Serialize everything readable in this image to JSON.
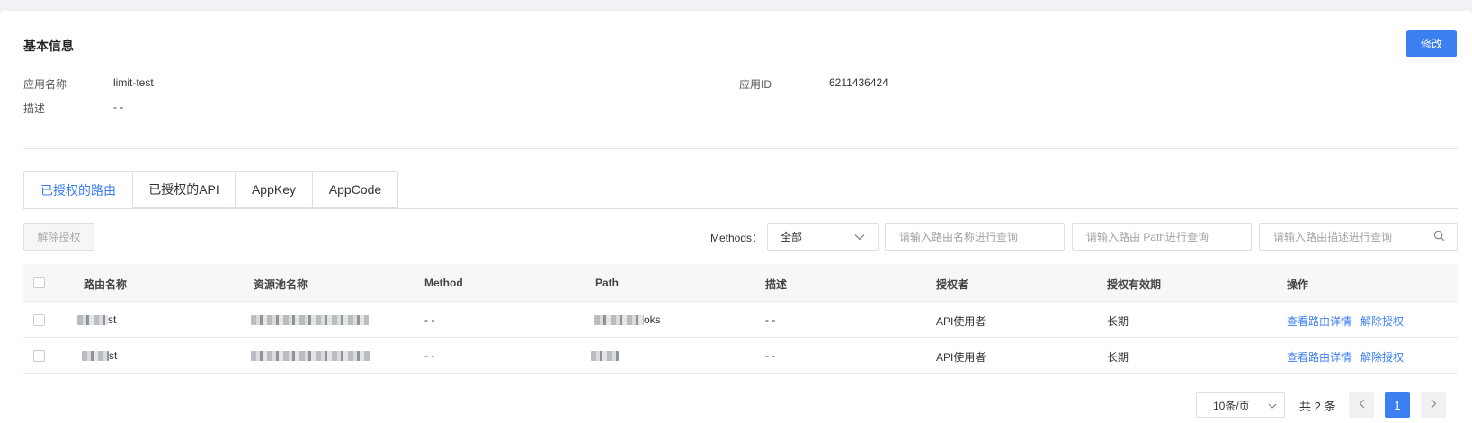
{
  "basic": {
    "title": "基本信息",
    "edit_label": "修改",
    "app_name_label": "应用名称",
    "app_name": "limit-test",
    "app_id_label": "应用ID",
    "app_id": "6211436424",
    "desc_label": "描述",
    "desc": "- -"
  },
  "tabs": [
    {
      "label": "已授权的路由"
    },
    {
      "label": "已授权的API"
    },
    {
      "label": "AppKey"
    },
    {
      "label": "AppCode"
    }
  ],
  "toolbar": {
    "revoke_label": "解除授权",
    "methods_label": "Methods：",
    "methods_value": "全部",
    "name_placeholder": "请输入路由名称进行查询",
    "path_placeholder": "请输入路由 Path进行查询",
    "desc_placeholder": "请输入路由描述进行查询"
  },
  "table": {
    "headers": [
      "路由名称",
      "资源池名称",
      "Method",
      "Path",
      "描述",
      "授权者",
      "授权有效期",
      "操作"
    ],
    "rows": [
      {
        "name_suffix": "st",
        "method": "- -",
        "path_suffix": "oks",
        "desc": "- -",
        "grantor": "API使用者",
        "validity": "长期",
        "action1": "查看路由详情",
        "action2": "解除授权"
      },
      {
        "name_suffix": "st",
        "method": "- -",
        "path_suffix": "",
        "desc": "- -",
        "grantor": "API使用者",
        "validity": "长期",
        "action1": "查看路由详情",
        "action2": "解除授权"
      }
    ]
  },
  "pagination": {
    "page_size": "10条/页",
    "total": "共 2 条",
    "current_page": "1"
  },
  "colors": {
    "accent": "#3b7ff0",
    "border": "#dcdfe6"
  }
}
